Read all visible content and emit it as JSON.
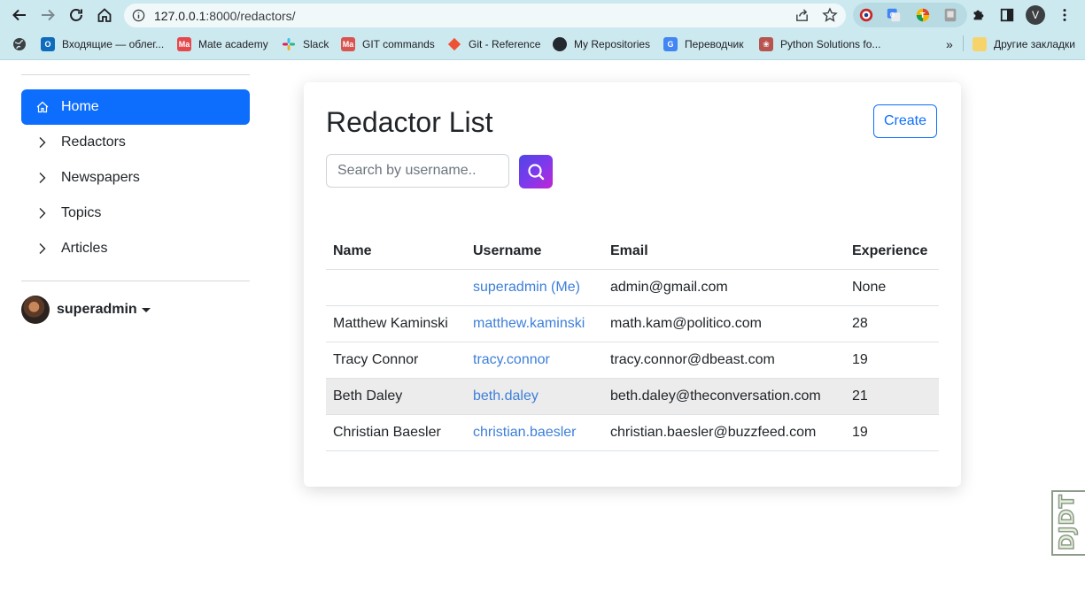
{
  "browser": {
    "url_host": "127.0.0.1",
    "url_rest": ":8000/redactors/",
    "profile_initial": "V",
    "bookmarks": [
      {
        "label": "Входящие — облег...",
        "color": "#0f6cbd",
        "glyph": "O"
      },
      {
        "label": "Mate academy",
        "color": "#e5484d",
        "glyph": "Ma"
      },
      {
        "label": "Slack",
        "color": "#4a154b",
        "glyph": "#"
      },
      {
        "label": "GIT commands",
        "color": "#d9534f",
        "glyph": "Ma"
      },
      {
        "label": "Git - Reference",
        "color": "#f05033",
        "glyph": "◆"
      },
      {
        "label": "My Repositories",
        "color": "#24292f",
        "glyph": "●"
      },
      {
        "label": "Переводчик",
        "color": "#4285f4",
        "glyph": "G"
      },
      {
        "label": "Python Solutions fo...",
        "color": "#b85450",
        "glyph": "❀"
      }
    ],
    "more_bookmarks": "»",
    "other_bookmarks": "Другие закладки"
  },
  "sidebar": {
    "items": [
      {
        "label": "Home",
        "icon": "home-icon",
        "active": true
      },
      {
        "label": "Redactors",
        "icon": "chevron-right-icon"
      },
      {
        "label": "Newspapers",
        "icon": "chevron-right-icon"
      },
      {
        "label": "Topics",
        "icon": "chevron-right-icon"
      },
      {
        "label": "Articles",
        "icon": "chevron-right-icon"
      }
    ],
    "user": {
      "name": "superadmin"
    }
  },
  "main": {
    "title": "Redactor List",
    "create_label": "Create",
    "search_placeholder": "Search by username..",
    "columns": [
      "Name",
      "Username",
      "Email",
      "Experience"
    ],
    "rows": [
      {
        "name": "",
        "username": "superadmin (Me)",
        "email": "admin@gmail.com",
        "experience": "None"
      },
      {
        "name": "Matthew Kaminski",
        "username": "matthew.kaminski",
        "email": "math.kam@politico.com",
        "experience": "28"
      },
      {
        "name": "Tracy Connor",
        "username": "tracy.connor",
        "email": "tracy.connor@dbeast.com",
        "experience": "19"
      },
      {
        "name": "Beth Daley",
        "username": "beth.daley",
        "email": "beth.daley@theconversation.com",
        "experience": "21"
      },
      {
        "name": "Christian Baesler",
        "username": "christian.baesler",
        "email": "christian.baesler@buzzfeed.com",
        "experience": "19"
      }
    ]
  },
  "debug_toolbar": {
    "label": "DJDT"
  },
  "colors": {
    "primary": "#0d6efd",
    "link": "#3d7fd9",
    "chrome": "#cde9f0"
  }
}
